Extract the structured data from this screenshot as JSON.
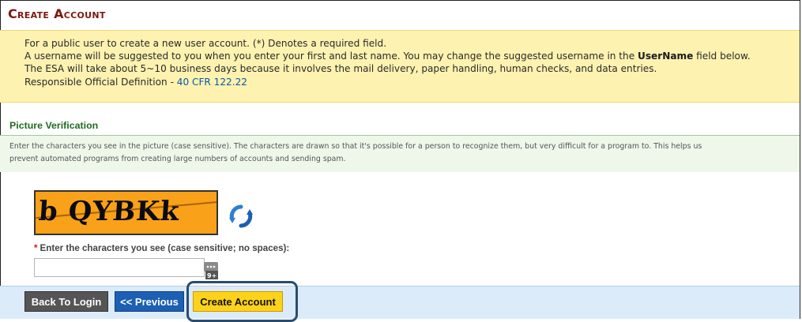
{
  "page": {
    "title": "Create Account"
  },
  "info": {
    "line1": "For a public user to create a new user account. (*) Denotes a required field.",
    "line2_before": "A username will be suggested to you when you enter your first and last name. You may change the suggested username in the ",
    "line2_bold": "UserName",
    "line2_after": " field below.",
    "line3": "The ESA will take about 5~10 business days because it involves the mail delivery, paper handling, human checks, and data entries.",
    "line4_prefix": "Responsible Official Definition - ",
    "line4_link": "40 CFR 122.22"
  },
  "picture_verification": {
    "title": "Picture Verification",
    "desc_line1": "Enter the characters you see in the picture (case sensitive). The characters are drawn so that it's possible for a person to recognize them, but very difficult for a program to. This helps us",
    "desc_line2": "prevent automated programs from creating large numbers of accounts and sending spam.",
    "captcha_text": "b QYBKk",
    "input_label": "Enter the characters you see (case sensitive; no spaces):",
    "required_mark": "*",
    "input_value": "",
    "keyboard_badge": "9+"
  },
  "buttons": {
    "back": "Back To Login",
    "previous": "<< Previous",
    "create": "Create Account"
  },
  "colors": {
    "title": "#7a1a12",
    "info_bg": "#fdf2b0",
    "section_title": "#1f6b1f",
    "captcha_bg": "#f8a119",
    "bottom_bar": "#dcebfa",
    "btn_back": "#555555",
    "btn_previous": "#1c5fb3",
    "btn_create": "#ffd21a"
  },
  "icons": {
    "refresh": "refresh-icon",
    "keyboard": "keyboard-icon"
  }
}
